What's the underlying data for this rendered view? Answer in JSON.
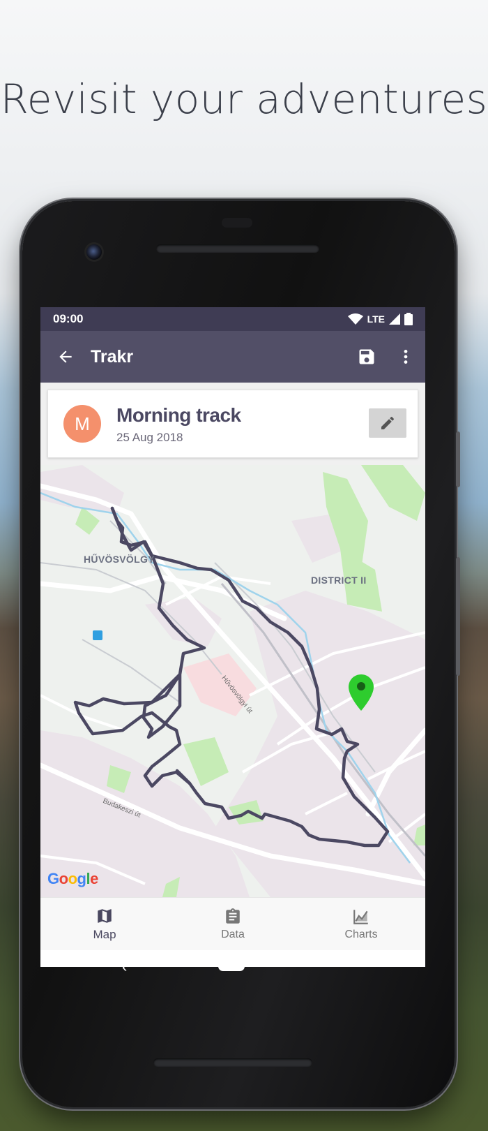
{
  "headline": "Revisit your adventures",
  "status_bar": {
    "time": "09:00",
    "network": "LTE",
    "icons": [
      "wifi-icon",
      "signal-icon",
      "battery-icon"
    ]
  },
  "app_bar": {
    "title": "Trakr",
    "back_icon": "arrow-back-icon",
    "actions": [
      "save-icon",
      "more-vert-icon"
    ]
  },
  "track_card": {
    "avatar_initial": "M",
    "name": "Morning track",
    "date": "25 Aug 2018",
    "edit_icon": "pencil-icon"
  },
  "map": {
    "labels": {
      "area1": "HŰVÖSVÖLGY",
      "area2": "DISTRICT II",
      "road1": "Hűvösvölgyi út",
      "road2": "Budakeszi út"
    },
    "attribution": "Google",
    "marker_color": "#2ecc2e",
    "track_color": "#4b4862"
  },
  "bottom_nav": {
    "items": [
      {
        "label": "Map",
        "icon": "map-icon",
        "active": true
      },
      {
        "label": "Data",
        "icon": "clipboard-icon",
        "active": false
      },
      {
        "label": "Charts",
        "icon": "chart-icon",
        "active": false
      }
    ]
  },
  "colors": {
    "status_bar": "#3f3c54",
    "app_bar": "#524f67",
    "avatar": "#f4906c"
  }
}
